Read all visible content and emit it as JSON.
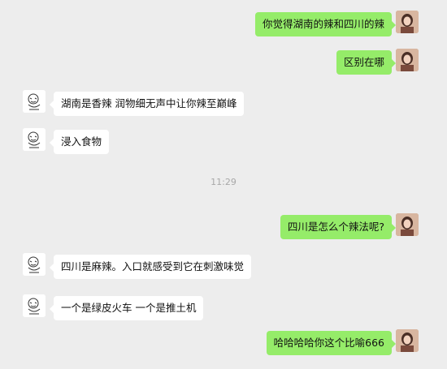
{
  "colors": {
    "background": "#ededed",
    "outgoing_bubble": "#95ec69",
    "incoming_bubble": "#ffffff",
    "timestamp_text": "#a8a8a8"
  },
  "messages": [
    {
      "side": "right",
      "text": "你觉得湖南的辣和四川的辣",
      "avatar": "woman-photo-avatar"
    },
    {
      "side": "right",
      "text": "区别在哪",
      "avatar": "woman-photo-avatar"
    },
    {
      "side": "left",
      "text": "湖南是香辣 润物细无声中让你辣至巅峰",
      "avatar": "meme-face-avatar"
    },
    {
      "side": "left",
      "text": "浸入食物",
      "avatar": "meme-face-avatar"
    },
    {
      "side": "right",
      "text": "四川是怎么个辣法呢?",
      "avatar": "woman-photo-avatar"
    },
    {
      "side": "left",
      "text": "四川是麻辣。入口就感受到它在刺激味觉",
      "avatar": "meme-face-avatar"
    },
    {
      "side": "left",
      "text": "一个是绿皮火车 一个是推土机",
      "avatar": "meme-face-avatar"
    },
    {
      "side": "right",
      "text": "哈哈哈哈你这个比喻666",
      "avatar": "woman-photo-avatar"
    }
  ],
  "timestamp": "11:29"
}
